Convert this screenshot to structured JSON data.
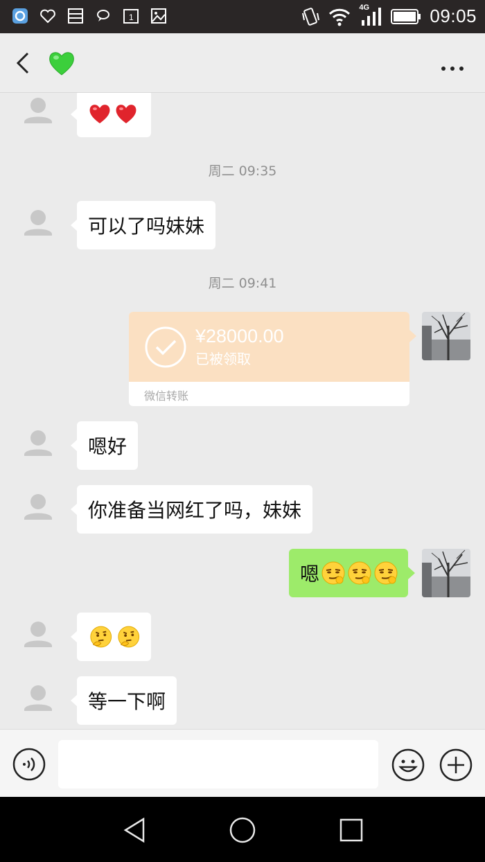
{
  "status_bar": {
    "network": "4G",
    "time": "09:05"
  },
  "header": {
    "title_icon": "green-heart-emoji",
    "back_icon": "chevron-left-icon",
    "more_icon": "more-dots-icon"
  },
  "messages": {
    "m1": {
      "side": "in",
      "content": "heart-emoji x2"
    },
    "ts1": "周二 09:35",
    "m2": {
      "side": "in",
      "text": "可以了吗妹妹"
    },
    "ts2": "周二 09:41",
    "transfer": {
      "side": "out",
      "amount": "¥28000.00",
      "status": "已被领取",
      "label": "微信转账"
    },
    "m4": {
      "side": "in",
      "text": "嗯好"
    },
    "m5": {
      "side": "in",
      "text": "你准备当网红了吗，妹妹"
    },
    "m6": {
      "side": "out",
      "text": "嗯",
      "emoji": "smirk-emoji x3"
    },
    "m7": {
      "side": "in",
      "content": "thinking-emoji x2"
    },
    "m8": {
      "side": "in",
      "text": "等一下啊"
    }
  },
  "input_bar": {
    "message_value": "",
    "voice_icon": "voice-icon",
    "emoji_icon": "emoji-icon",
    "plus_icon": "plus-icon"
  },
  "colors": {
    "sent_bubble": "#9deb6a",
    "transfer_card": "#fbe0c2",
    "chat_bg": "#ebebeb"
  }
}
